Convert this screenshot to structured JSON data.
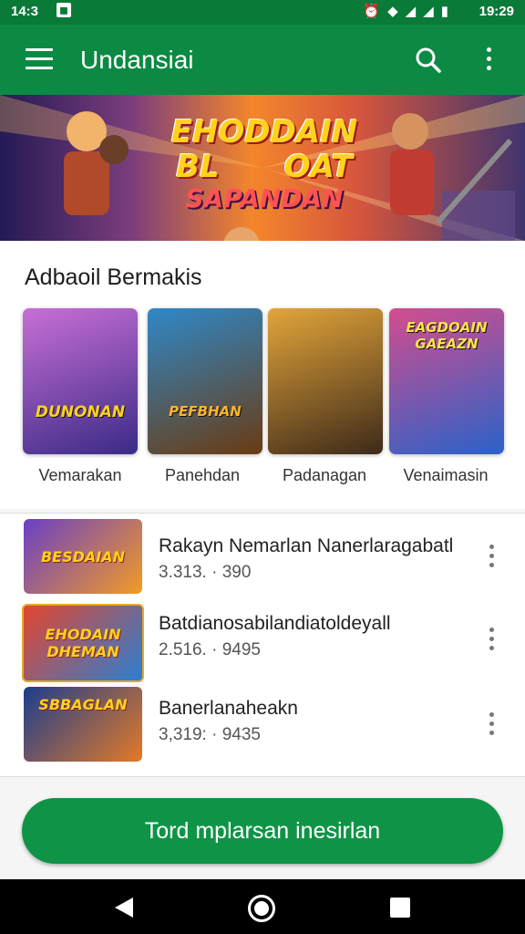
{
  "status_bar": {
    "time": "14:3",
    "clock": "19:29"
  },
  "app_bar": {
    "title": "Undansiai"
  },
  "hero": {
    "line1": "EHODDAIN",
    "line2": "BL      OAT",
    "line3": "SAPANDAN"
  },
  "section": {
    "title": "Adbaoil Bermakis",
    "cards": [
      {
        "label": "Vemarakan",
        "logo": "DUNONAN",
        "colors": [
          "#c86fd6",
          "#3a2b86"
        ]
      },
      {
        "label": "Panehdan",
        "logo": "PEFBHAN",
        "colors": [
          "#2f88c8",
          "#6a3b12"
        ]
      },
      {
        "label": "Padanagan",
        "logo": "",
        "colors": [
          "#e3a53a",
          "#3d2a1a"
        ]
      },
      {
        "label": "Venaimasin",
        "logo": "EAGDOAIN GAEAZN",
        "colors": [
          "#d44d8e",
          "#2a62c8"
        ]
      }
    ]
  },
  "list": [
    {
      "title": "Rakayn Nemarlan Nanerlaragabatl",
      "meta": "3.313. · 390",
      "thumb": "BESDAIAN",
      "colors": [
        "#6a3fc7",
        "#f29b24"
      ]
    },
    {
      "title": "Batdianosabilandiatoldeyall",
      "meta": "2.516. · 9495",
      "thumb": "EHODAIN DHEMAN",
      "colors": [
        "#e4452e",
        "#2b7fd1"
      ]
    },
    {
      "title": "Banerlanaheakn",
      "meta": "3,319: · 9435",
      "thumb": "SBBAGLAN",
      "colors": [
        "#1c3d8e",
        "#e37a27"
      ]
    }
  ],
  "cta": {
    "label": "Tord mplarsan inesirlan"
  }
}
